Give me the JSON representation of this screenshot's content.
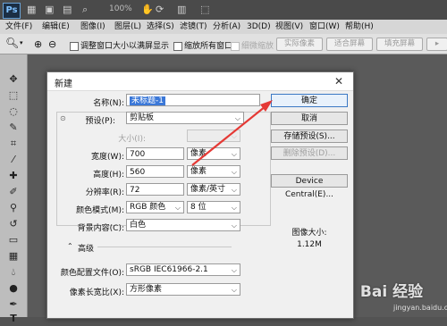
{
  "app": {
    "logo": "Ps",
    "zoom": "100%"
  },
  "menubar": [
    "文件(F)",
    "编辑(E)",
    "图像(I)",
    "图层(L)",
    "选择(S)",
    "滤镜(T)",
    "分析(A)",
    "3D(D)",
    "视图(V)",
    "窗口(W)",
    "帮助(H)"
  ],
  "options": {
    "fit_window": "调整窗口大小以满屏显示",
    "zoom_all": "缩放所有窗口",
    "scrubby": "细微缩放",
    "actual_pixels": "实际像素",
    "fit_screen": "适合屏幕",
    "fill_screen": "填充屏幕"
  },
  "dialog": {
    "title": "新建",
    "name_label": "名称(N):",
    "name_value": "未标题-1",
    "preset_label": "预设(P):",
    "preset_value": "剪贴板",
    "size_label": "大小(I):",
    "width_label": "宽度(W):",
    "width_value": "700",
    "width_unit": "像素",
    "height_label": "高度(H):",
    "height_value": "560",
    "height_unit": "像素",
    "resolution_label": "分辨率(R):",
    "resolution_value": "72",
    "resolution_unit": "像素/英寸",
    "color_mode_label": "颜色模式(M):",
    "color_mode_value": "RGB 颜色",
    "bit_depth_value": "8 位",
    "background_label": "背景内容(C):",
    "background_value": "白色",
    "advanced_label": "高级",
    "color_profile_label": "颜色配置文件(O):",
    "color_profile_value": "sRGB IEC61966-2.1",
    "pixel_aspect_label": "像素长宽比(X):",
    "pixel_aspect_value": "方形像素",
    "ok_button": "确定",
    "cancel_button": "取消",
    "save_preset_button": "存储预设(S)...",
    "delete_preset_button": "删除预设(D)...",
    "device_central_button": "Device Central(E)...",
    "image_size_label": "图像大小:",
    "image_size_value": "1.12M"
  },
  "watermark": {
    "text": "Bai 经验",
    "sub": "jingyan.baidu.com"
  },
  "colors": {
    "accent": "#3b78d8",
    "annotation": "#e53935"
  }
}
